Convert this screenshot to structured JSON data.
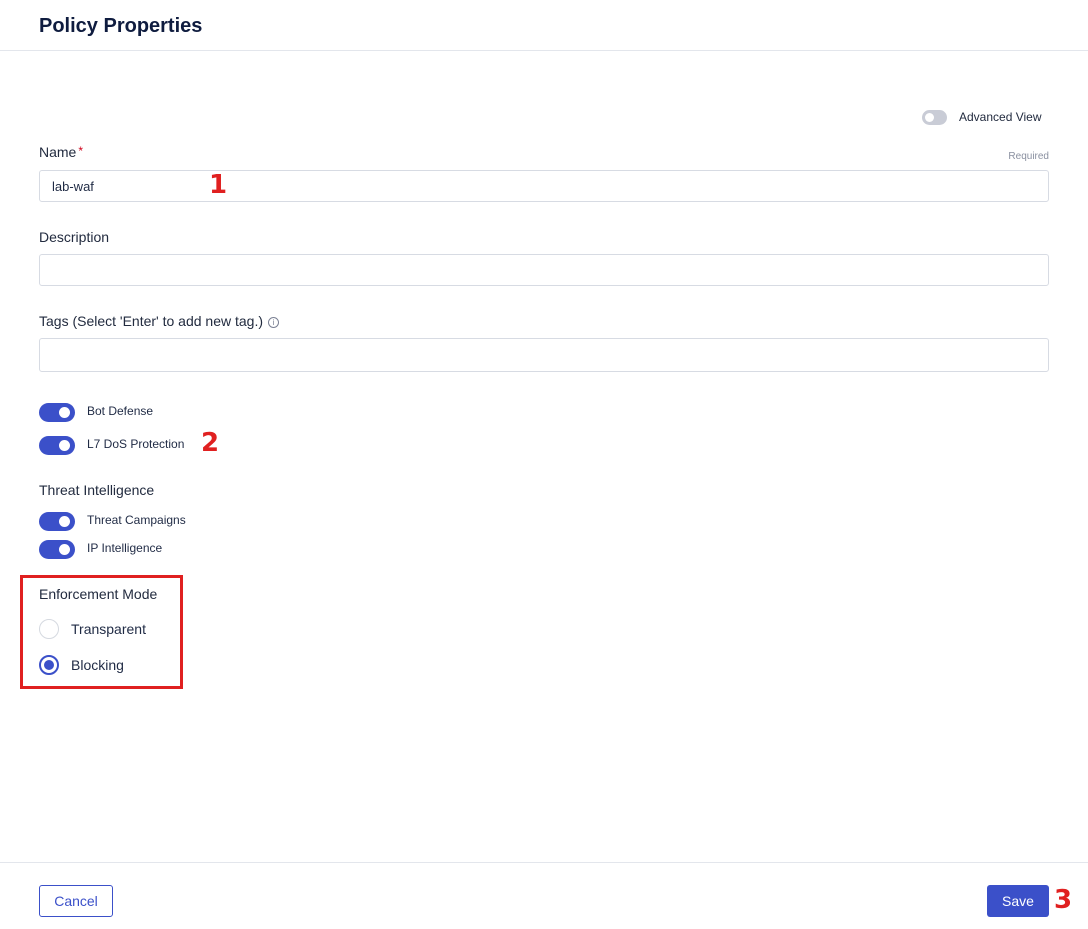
{
  "header": {
    "title": "Policy Properties"
  },
  "advanced_view": {
    "label": "Advanced View",
    "enabled": false
  },
  "form": {
    "name": {
      "label": "Name",
      "required_marker": "*",
      "hint": "Required",
      "value": "lab-waf"
    },
    "description": {
      "label": "Description",
      "value": ""
    },
    "tags": {
      "label": "Tags (Select 'Enter' to add new tag.)",
      "info_glyph": "i",
      "value": ""
    }
  },
  "toggles": [
    {
      "label": "Bot Defense",
      "enabled": true
    },
    {
      "label": "L7 DoS Protection",
      "enabled": true
    }
  ],
  "threat_intelligence": {
    "label": "Threat Intelligence",
    "toggles": [
      {
        "label": "Threat Campaigns",
        "enabled": true
      },
      {
        "label": "IP Intelligence",
        "enabled": true
      }
    ]
  },
  "enforcement_mode": {
    "label": "Enforcement Mode",
    "options": [
      {
        "label": "Transparent",
        "selected": false
      },
      {
        "label": "Blocking",
        "selected": true
      }
    ]
  },
  "annotations": [
    "1",
    "2",
    "3"
  ],
  "footer": {
    "cancel_label": "Cancel",
    "save_label": "Save"
  },
  "colors": {
    "accent": "#3b50c9",
    "annotation": "#e02020",
    "border": "#d7dbe3"
  }
}
